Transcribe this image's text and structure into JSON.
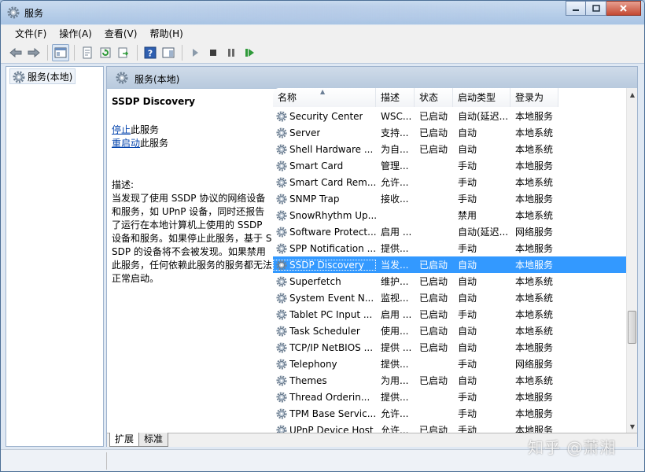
{
  "window": {
    "title": "服务"
  },
  "menu": [
    "文件(F)",
    "操作(A)",
    "查看(V)",
    "帮助(H)"
  ],
  "toolbar": {
    "icons": [
      "back-arrow-icon",
      "forward-arrow-icon",
      "console-tree-icon",
      "properties-icon",
      "refresh-icon",
      "export-icon",
      "help-icon",
      "action-pane-icon",
      "start-icon",
      "stop-icon",
      "pause-icon",
      "restart-icon"
    ]
  },
  "tree": {
    "root_label": "服务(本地)"
  },
  "pane": {
    "header_title": "服务(本地)"
  },
  "details": {
    "service_name": "SSDP Discovery",
    "stop_link": "停止",
    "stop_suffix": "此服务",
    "restart_link": "重启动",
    "restart_suffix": "此服务",
    "description_label": "描述:",
    "description_text": "当发现了使用 SSDP 协议的网络设备和服务，如 UPnP 设备，同时还报告了运行在本地计算机上使用的 SSDP 设备和服务。如果停止此服务，基于 SSDP 的设备将不会被发现。如果禁用此服务，任何依赖此服务的服务都无法正常启动。"
  },
  "list": {
    "columns": [
      "名称",
      "描述",
      "状态",
      "启动类型",
      "登录为"
    ],
    "rows": [
      {
        "name": "Security Center",
        "desc": "WSC...",
        "status": "已启动",
        "startup": "自动(延迟...",
        "logon": "本地服务"
      },
      {
        "name": "Server",
        "desc": "支持...",
        "status": "已启动",
        "startup": "自动",
        "logon": "本地系统"
      },
      {
        "name": "Shell Hardware ...",
        "desc": "为自...",
        "status": "已启动",
        "startup": "自动",
        "logon": "本地系统"
      },
      {
        "name": "Smart Card",
        "desc": "管理...",
        "status": "",
        "startup": "手动",
        "logon": "本地服务"
      },
      {
        "name": "Smart Card Rem...",
        "desc": "允许...",
        "status": "",
        "startup": "手动",
        "logon": "本地系统"
      },
      {
        "name": "SNMP Trap",
        "desc": "接收...",
        "status": "",
        "startup": "手动",
        "logon": "本地服务"
      },
      {
        "name": "SnowRhythm Up...",
        "desc": "",
        "status": "",
        "startup": "禁用",
        "logon": "本地系统"
      },
      {
        "name": "Software Protect...",
        "desc": "启用 ...",
        "status": "",
        "startup": "自动(延迟...",
        "logon": "网络服务"
      },
      {
        "name": "SPP Notification ...",
        "desc": "提供...",
        "status": "",
        "startup": "手动",
        "logon": "本地服务"
      },
      {
        "name": "SSDP Discovery",
        "desc": "当发...",
        "status": "已启动",
        "startup": "自动",
        "logon": "本地服务",
        "selected": true
      },
      {
        "name": "Superfetch",
        "desc": "维护...",
        "status": "已启动",
        "startup": "自动",
        "logon": "本地系统"
      },
      {
        "name": "System Event N...",
        "desc": "监视...",
        "status": "已启动",
        "startup": "自动",
        "logon": "本地系统"
      },
      {
        "name": "Tablet PC Input ...",
        "desc": "启用 ...",
        "status": "已启动",
        "startup": "手动",
        "logon": "本地系统"
      },
      {
        "name": "Task Scheduler",
        "desc": "使用...",
        "status": "已启动",
        "startup": "自动",
        "logon": "本地系统"
      },
      {
        "name": "TCP/IP NetBIOS ...",
        "desc": "提供 ...",
        "status": "已启动",
        "startup": "自动",
        "logon": "本地服务"
      },
      {
        "name": "Telephony",
        "desc": "提供...",
        "status": "",
        "startup": "手动",
        "logon": "网络服务"
      },
      {
        "name": "Themes",
        "desc": "为用...",
        "status": "已启动",
        "startup": "自动",
        "logon": "本地系统"
      },
      {
        "name": "Thread Orderin...",
        "desc": "提供...",
        "status": "",
        "startup": "手动",
        "logon": "本地服务"
      },
      {
        "name": "TPM Base Servic...",
        "desc": "允许...",
        "status": "",
        "startup": "手动",
        "logon": "本地服务"
      },
      {
        "name": "UPnP Device Host",
        "desc": "允许...",
        "status": "已启动",
        "startup": "手动",
        "logon": "本地服务"
      }
    ]
  },
  "tabs": [
    "扩展",
    "标准"
  ],
  "watermark": "知乎 @萧湘",
  "colors": {
    "selection": "#3399ff",
    "link": "#0645ad",
    "header_gradient_top": "#cfdbe9"
  }
}
